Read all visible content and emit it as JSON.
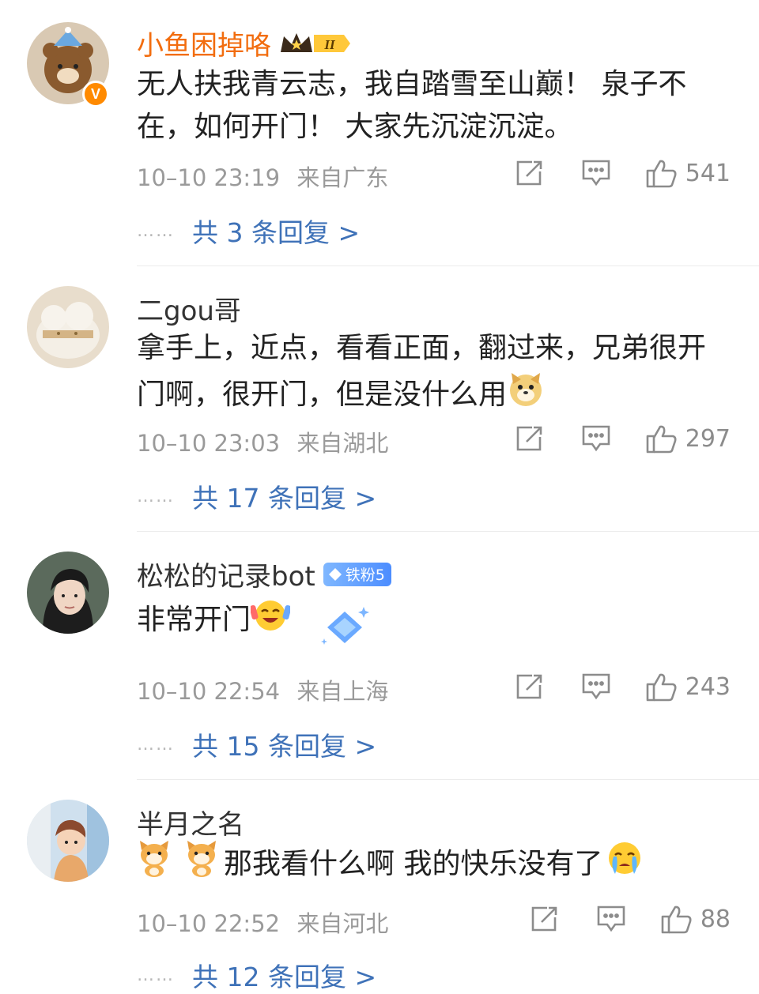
{
  "comments": [
    {
      "username": "小鱼困掉咯",
      "crown_level": "II",
      "verified_mark": "V",
      "text_lines": [
        "无人扶我青云志，我自踏雪至山巅！ 泉子不",
        "在，如何开门！ 大家先沉淀沉淀。"
      ],
      "time": "10–10 23:19",
      "location": "来自广东",
      "likes": "541",
      "replies_dots": "……",
      "replies_label": "共 3 条回复 >"
    },
    {
      "username": "二gou哥",
      "text_lines": [
        "拿手上，近点，看看正面，翻过来，兄弟很开",
        "门啊，很开门，但是没什么用"
      ],
      "time": "10–10 23:03",
      "location": "来自湖北",
      "likes": "297",
      "replies_dots": "……",
      "replies_label": "共 17 条回复 >"
    },
    {
      "username": "松松的记录bot",
      "fan_badge": "铁粉5",
      "text_lines": [
        "非常开门"
      ],
      "time": "10–10 22:54",
      "location": "来自上海",
      "likes": "243",
      "replies_dots": "……",
      "replies_label": "共 15 条回复 >"
    },
    {
      "username": "半月之名",
      "text_lines": [
        "那我看什么啊 我的快乐没有了"
      ],
      "time": "10–10 22:52",
      "location": "来自河北",
      "likes": "88",
      "replies_dots": "……",
      "replies_label": "共 12 条回复 >"
    }
  ],
  "icons": {
    "share": "share-icon",
    "comment": "comment-icon",
    "like": "thumbs-up-icon",
    "verified": "verified-badge-icon",
    "crown": "crown-badge-icon",
    "fan": "diamond-icon"
  },
  "colors": {
    "vip_name": "#f26d0f",
    "name": "#333333",
    "reply_link": "#3f72b8",
    "meta": "#9a9a9a",
    "verified_badge": "#ff8a00"
  }
}
